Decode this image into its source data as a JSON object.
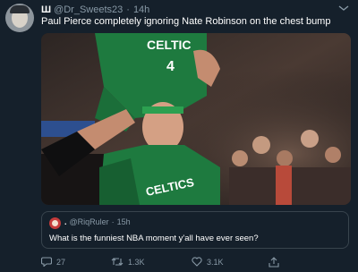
{
  "tweet": {
    "badge": "Ш",
    "handle": "@Dr_Sweets23",
    "separator": "·",
    "time": "14h",
    "text": "Paul Pierce completely ignoring Nate Robinson on the chest bump",
    "media": {
      "jersey_top_text": "CELTIC",
      "jersey_top_number": "4",
      "jersey_bottom_text": "CELTICS"
    }
  },
  "quote": {
    "name": ".",
    "handle": "@RiqRuler",
    "separator": "·",
    "time": "15h",
    "text": "What is the funniest NBA moment y'all have ever seen?"
  },
  "actions": {
    "reply_count": "27",
    "retweet_count": "1.3K",
    "like_count": "3.1K"
  },
  "colors": {
    "background": "#15202b",
    "secondary_text": "#8899a6",
    "border": "#38444d",
    "celtics_green": "#1e7a3f"
  },
  "icons": [
    "more-icon",
    "reply-icon",
    "retweet-icon",
    "like-icon",
    "share-icon"
  ]
}
